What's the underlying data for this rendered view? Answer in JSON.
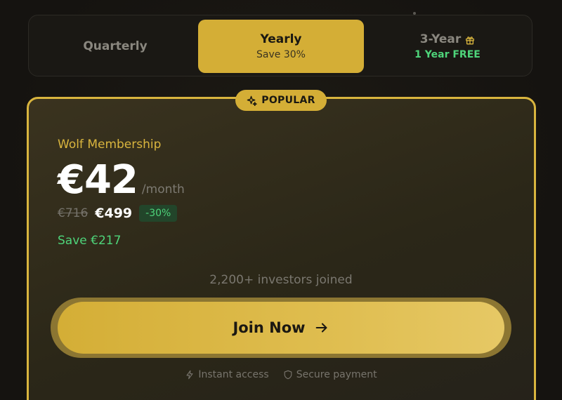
{
  "billing": {
    "options": [
      {
        "label": "Quarterly",
        "sub": ""
      },
      {
        "label": "Yearly",
        "sub": "Save 30%"
      },
      {
        "label": "3-Year",
        "sub": "1 Year FREE"
      }
    ],
    "selected": "Yearly"
  },
  "card": {
    "badge": "POPULAR",
    "plan_name": "Wolf Membership",
    "price": "€42",
    "period": "/month",
    "original_total": "€716",
    "discounted_total": "€499",
    "discount_badge": "-30%",
    "savings": "Save €217",
    "social_proof": "2,200+ investors joined",
    "cta_label": "Join Now",
    "trust": {
      "instant": "Instant access",
      "secure": "Secure payment"
    }
  },
  "icons": {
    "badge": "sparkle-icon",
    "gift": "gift-icon",
    "cta": "arrow-right-icon",
    "instant": "lightning-icon",
    "secure": "shield-icon"
  },
  "colors": {
    "accent": "#d4ae36",
    "success": "#4ed47a",
    "background": "#171511"
  }
}
